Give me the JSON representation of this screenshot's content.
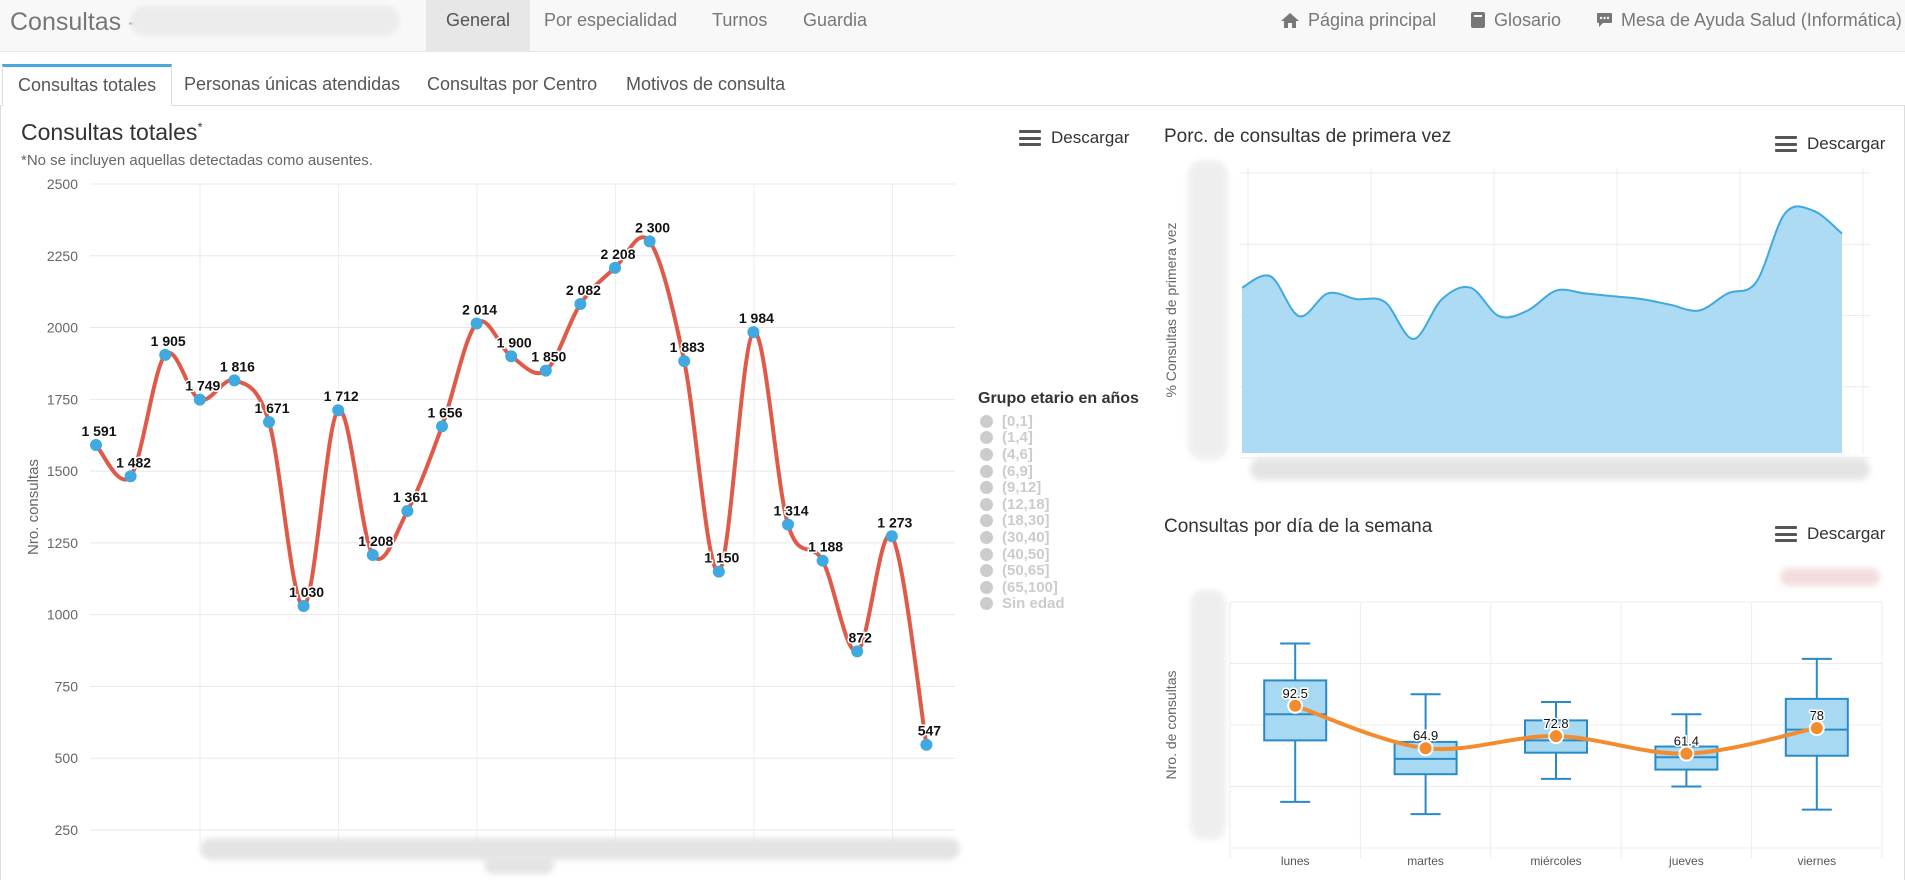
{
  "navbar": {
    "brand": "Consultas -",
    "items": [
      "General",
      "Por especialidad",
      "Turnos",
      "Guardia"
    ],
    "right": [
      {
        "label": "Página principal",
        "icon": "home-icon"
      },
      {
        "label": "Glosario",
        "icon": "book-icon"
      },
      {
        "label": "Mesa de Ayuda Salud (Informática)",
        "icon": "comment-icon"
      }
    ]
  },
  "tabs": [
    "Consultas totales",
    "Personas únicas atendidas",
    "Consultas por Centro",
    "Motivos de consulta"
  ],
  "download_label": "Descargar",
  "main_chart": {
    "title": "Consultas totales",
    "title_mark": "*",
    "subtitle": "*No se incluyen aquellas detectadas como ausentes.",
    "ylabel": "Nro. consultas",
    "legend_title": "Grupo etario en años",
    "legend_items": [
      "[0,1]",
      "(1,4]",
      "(4,6]",
      "(6,9]",
      "(9,12]",
      "(12,18]",
      "(18,30]",
      "(30,40]",
      "(40,50]",
      "(50,65]",
      "(65,100]",
      "Sin edad"
    ]
  },
  "top_right_chart": {
    "title": "Porc. de consultas de primera vez",
    "ylabel": "% Consultas de primera vez"
  },
  "bottom_right_chart": {
    "title": "Consultas por día de la semana",
    "ylabel": "Nro. de consultas"
  },
  "colors": {
    "line": "#e05a4a",
    "point": "#3fa9e0",
    "area": "#a8d9f2",
    "area_stroke": "#3fa9e0",
    "box_fill": "#a8d9f2",
    "box_stroke": "#2a8ac8",
    "mean_line": "#f28c2e",
    "tab_accent": "#4aa8e0"
  },
  "chart_data": [
    {
      "type": "line",
      "title": "Consultas totales",
      "ylabel": "Nro. consultas",
      "ylim": [
        250,
        2500
      ],
      "yticks": [
        250,
        500,
        750,
        1000,
        1250,
        1500,
        1750,
        2000,
        2250,
        2500
      ],
      "values": [
        1591,
        1482,
        1905,
        1749,
        1816,
        1671,
        1030,
        1712,
        1208,
        1361,
        1656,
        2014,
        1900,
        1850,
        2082,
        2208,
        2300,
        1883,
        1150,
        1984,
        1314,
        1188,
        872,
        1273,
        547
      ],
      "labels": [
        "1 591",
        "1 482",
        "1 905",
        "1 749",
        "1 816",
        "1 671",
        "1 030",
        "1 712",
        "1 208",
        "1 361",
        "1 656",
        "2 014",
        "1 900",
        "1 850",
        "2 082",
        "2 208",
        "2 300",
        "1 883",
        "1 150",
        "1 984",
        "1 314",
        "1 188",
        "872",
        "1 273",
        "547"
      ],
      "grid": true
    },
    {
      "type": "area",
      "title": "Porc. de consultas de primera vez",
      "ylabel": "% Consultas de primera vez",
      "values": [
        58,
        62,
        48,
        56,
        54,
        53,
        40,
        54,
        58,
        48,
        50,
        57,
        56,
        55,
        54,
        52,
        50,
        56,
        60,
        84,
        85,
        77
      ],
      "grid": true
    },
    {
      "type": "box",
      "title": "Consultas por día de la semana",
      "ylabel": "Nro. de consultas",
      "categories": [
        "lunes",
        "martes",
        "miércoles",
        "jueves",
        "viernes"
      ],
      "box": [
        {
          "min": 30,
          "q1": 70,
          "median": 87,
          "q3": 109,
          "max": 133
        },
        {
          "min": 22,
          "q1": 48,
          "median": 58,
          "q3": 69,
          "max": 100
        },
        {
          "min": 45,
          "q1": 62,
          "median": 70,
          "q3": 83,
          "max": 95
        },
        {
          "min": 40,
          "q1": 51,
          "median": 59,
          "q3": 66,
          "max": 87
        },
        {
          "min": 25,
          "q1": 60,
          "median": 77,
          "q3": 97,
          "max": 123
        }
      ],
      "means": [
        92.5,
        64.9,
        72.8,
        61.4,
        78
      ],
      "mean_labels": [
        "92.5",
        "64.9",
        "72.8",
        "61.4",
        "78"
      ],
      "ylim": [
        0,
        160
      ],
      "grid": true
    }
  ]
}
